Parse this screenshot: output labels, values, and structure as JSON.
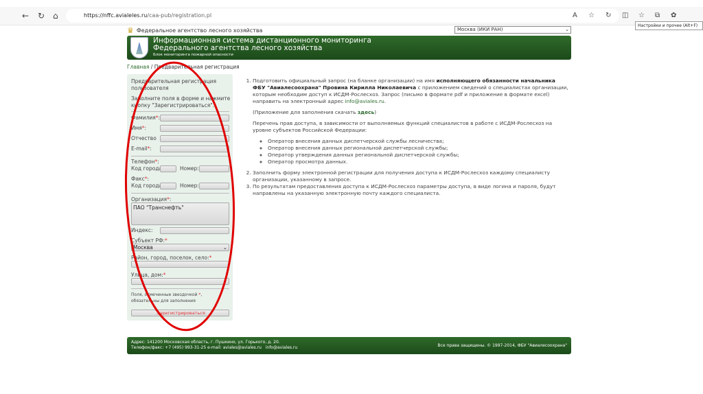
{
  "browser": {
    "url_host": "https://nffc.avialeles.ru",
    "url_path": "/caa-pub/registration.pl",
    "tooltip": "Настройки и прочее (Alt+F)"
  },
  "header": {
    "agency": "Федеральное агентство лесного хозяйства",
    "region_select": "Москва (ИКИ РАН)",
    "title_line1": "Информационная система дистанционного мониторинга",
    "title_line2": "Федерального агентства лесного хозяйства",
    "subtitle": "Блок мониторинга пожарной опасности"
  },
  "breadcrumb": {
    "home": "Главная",
    "sep": " / ",
    "current": "Предварительная регистрация"
  },
  "form": {
    "title": "Предварительная регистрация пользователя",
    "intro": "Заполните поля в форме и нажмите кнопку \"Зарегистрироваться\".",
    "surname": "Фамилия",
    "name": "Имя",
    "patronymic": "Отчество",
    "email": "E-mail",
    "phone": "Телефон",
    "city_code": "Код города:",
    "number": "Номер:",
    "fax": "Факс",
    "org": "Организация",
    "org_value": "ПАО \"Транснефть\"",
    "index": "Индекс:",
    "subject": "Субъект РФ:",
    "subject_value": "Москва",
    "district": "Район, город, поселок, село:",
    "street": "Улица, дом:",
    "note_before": "Поля, отмеченные звездочкой ",
    "note_after": ", обязательны для заполнения",
    "star": "*",
    "submit": "Зарегистрироваться"
  },
  "content": {
    "item1_a": "Подготовить официальный запрос (на бланке организации) на имя ",
    "item1_bold": "исполняющего обязанности начальника ФБУ \"Авиалесоохрана\" Провина Кирилла Николаевича",
    "item1_b": " с приложением сведений о специалистах организации, которым необходим доступ к ИСДМ-Рослесхоз. Запрос (письмо в формате pdf и приложение в формате excel) направить на электронный адрес ",
    "item1_email": "info@aviales.ru",
    "appendix_a": "(Приложение для заполнения скачать ",
    "appendix_link": "здесь",
    "appendix_b": ")",
    "rights_intro": "Перечень прав доступа, в зависимости от выполняемых функций специалистов в работе с ИСДМ-Рослесхоз на уровне субъектов Российской Федерации:",
    "rights": [
      "Оператор внесения данных диспетчерской службы лесничества;",
      "Оператор внесения данных региональной диспетчерской службы;",
      "Оператор утверждения данных региональной диспетчерской службы;",
      "Оператор просмотра данных."
    ],
    "item2": "Заполнить форму электронной регистрации для получения доступа к ИСДМ-Рослесхоз каждому специалисту организации, указанному в запросе.",
    "item3": "По результатам предоставления доступа к ИСДМ-Рослесхоз параметры доступа, в виде логина и пароля, будут направлены на указанную электронную почту каждого специалиста."
  },
  "footer": {
    "address": "Адрес: 141200 Московская область, г. Пушкино, ул. Горького, д. 20.",
    "phone": "Телефон/факс: +7 (495) 993-31-25   e-mail: ",
    "email1": "aviales@aviales.ru",
    "email2": "info@aviales.ru",
    "rights": "Все права защищены. © 1997-2014, ",
    "org_link": "ФБУ \"Авиалесоохрана\""
  },
  "colors": {
    "banner": "#1f4f1c",
    "annotation": "#e00000",
    "link": "#2a6a2a"
  }
}
